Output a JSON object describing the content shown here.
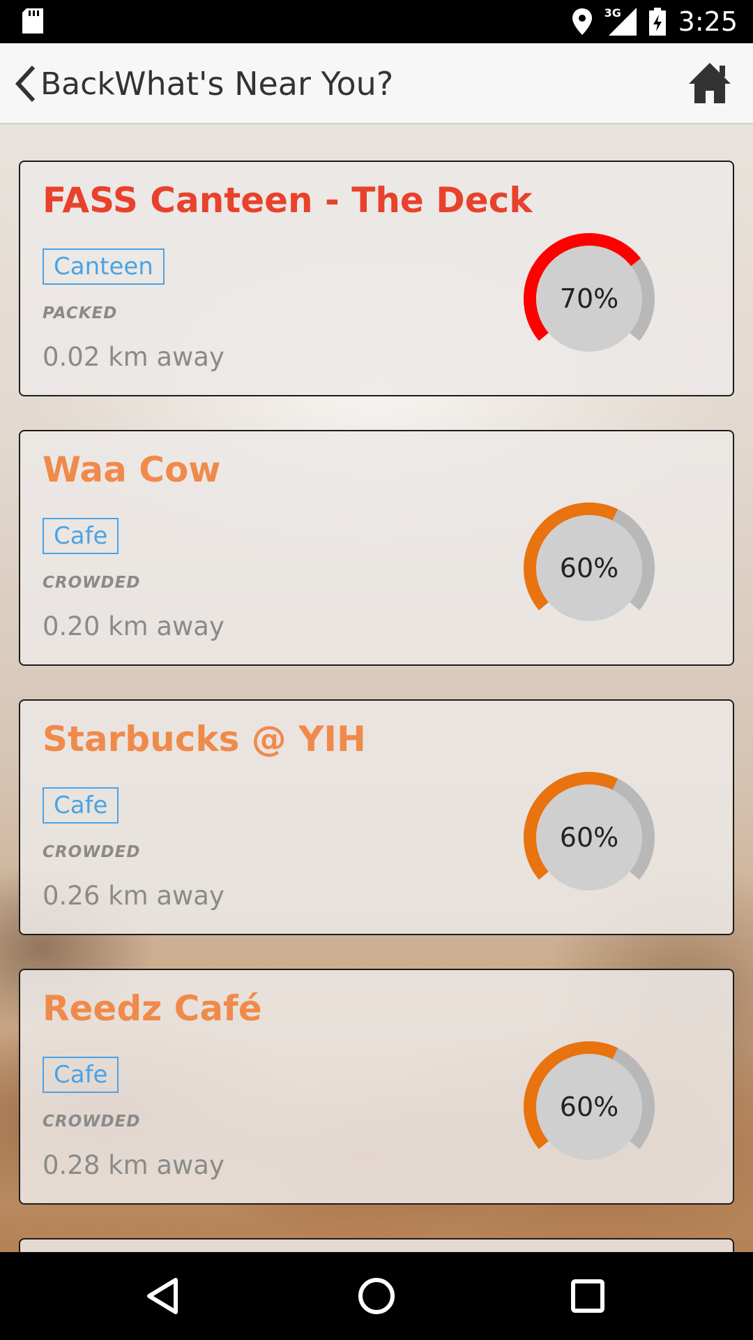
{
  "status_bar": {
    "time": "3:25",
    "network": "3G",
    "icons": [
      "sd-card-icon",
      "location-icon",
      "signal-icon",
      "battery-charging-icon"
    ]
  },
  "header": {
    "back_label": "Back",
    "title": "What's Near You?",
    "back_icon": "chevron-left-icon",
    "home_icon": "home-icon"
  },
  "colors": {
    "packed": "#e8412c",
    "crowded": "#f08a4b",
    "tag": "#4aa3e6",
    "gauge_packed": "#ff0000",
    "gauge_crowded": "#e8730f",
    "gauge_track": "#b8b8b8",
    "gauge_center": "#cfcfcf"
  },
  "places": [
    {
      "name": "FASS Canteen - The Deck",
      "tag": "Canteen",
      "status": "PACKED",
      "distance": "0.02 km away",
      "percent_label": "70%",
      "percent": 70,
      "level": "packed"
    },
    {
      "name": "Waa Cow",
      "tag": "Cafe",
      "status": "CROWDED",
      "distance": "0.20 km away",
      "percent_label": "60%",
      "percent": 60,
      "level": "crowded"
    },
    {
      "name": "Starbucks @ YIH",
      "tag": "Cafe",
      "status": "CROWDED",
      "distance": "0.26 km away",
      "percent_label": "60%",
      "percent": 60,
      "level": "crowded"
    },
    {
      "name": "Reedz Café",
      "tag": "Cafe",
      "status": "CROWDED",
      "distance": "0.28 km away",
      "percent_label": "60%",
      "percent": 60,
      "level": "crowded"
    }
  ],
  "nav_bar": {
    "icons": [
      "back-triangle-icon",
      "home-circle-icon",
      "recents-square-icon"
    ]
  }
}
